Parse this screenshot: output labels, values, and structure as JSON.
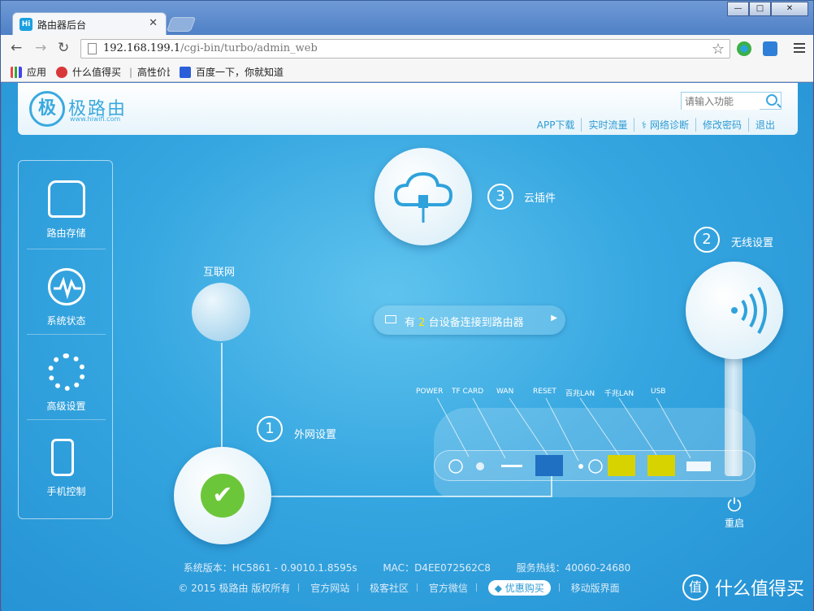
{
  "browser": {
    "tab_title": "路由器后台",
    "tab_favicon": "Hi",
    "url_host": "192.168.199.1",
    "url_path": "/cgi-bin/turbo/admin_web",
    "win_min": "▭",
    "win_max": "□",
    "win_close": "✕"
  },
  "bookmarks": [
    {
      "label": "应用",
      "icon": "apps-icon"
    },
    {
      "label": "什么值得买",
      "icon": "smzdm-icon"
    },
    {
      "label": "高性价比",
      "icon": "text"
    },
    {
      "label": "百度一下，你就知道",
      "icon": "baidu-paw-icon"
    }
  ],
  "header": {
    "logo_char": "极",
    "brand": "极路由",
    "brand_url": "www.hiwifi.com",
    "search_placeholder": "请输入功能",
    "links": [
      "APP下载",
      "实时流量",
      "网络诊断",
      "修改密码",
      "退出"
    ]
  },
  "sidebar": {
    "items": [
      {
        "label": "路由存储",
        "icon": "storage-icon"
      },
      {
        "label": "系统状态",
        "icon": "pulse-icon"
      },
      {
        "label": "高级设置",
        "icon": "gear-icon"
      },
      {
        "label": "手机控制",
        "icon": "phone-icon"
      }
    ]
  },
  "main": {
    "internet_label": "互联网",
    "step1": {
      "num": "1",
      "label": "外网设置"
    },
    "step2": {
      "num": "2",
      "label": "无线设置"
    },
    "step3": {
      "num": "3",
      "label": "云插件"
    },
    "devices": {
      "prefix": "有",
      "count": "2",
      "suffix": "台设备连接到路由器"
    },
    "ports": [
      "POWER",
      "TF CARD",
      "WAN",
      "RESET",
      "百兆LAN",
      "千兆LAN",
      "USB"
    ],
    "reboot_label": "重启"
  },
  "footer": {
    "version_label": "系统版本：",
    "version": "HC5861 - 0.9010.1.8595s",
    "mac_label": "MAC：",
    "mac": "D4EE072562C8",
    "hotline_label": "服务热线：",
    "hotline": "40060-24680",
    "copyright": "© 2015 极路由 版权所有",
    "links": [
      "官方网站",
      "极客社区",
      "官方微信"
    ],
    "buy": "优惠购买",
    "mobile": "移动版界面"
  },
  "watermark": "什么值得买",
  "colors": {
    "accent": "#3aa9df",
    "ok_green": "#6cc63a",
    "port_yellow": "#d7d300",
    "port_blue": "#1f6fc3"
  }
}
